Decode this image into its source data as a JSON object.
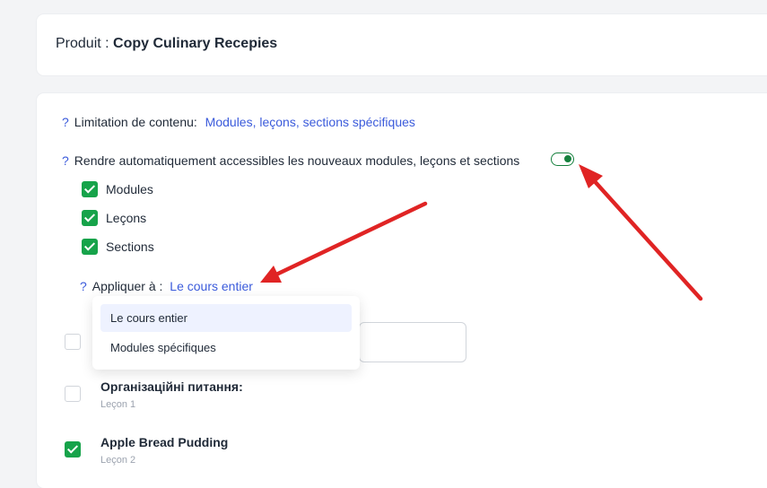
{
  "header": {
    "prefix": "Produit : ",
    "product_name": "Copy Culinary Recepies"
  },
  "content_limit": {
    "help": "?",
    "label": "Limitation de contenu:",
    "value": "Modules, leçons, sections spécifiques"
  },
  "auto_access": {
    "help": "?",
    "label": "Rendre automatiquement accessibles les nouveaux modules, leçons et sections",
    "enabled": true
  },
  "auto_access_items": [
    {
      "label": "Modules",
      "checked": true
    },
    {
      "label": "Leçons",
      "checked": true
    },
    {
      "label": "Sections",
      "checked": true
    }
  ],
  "apply_to": {
    "help": "?",
    "label": "Appliquer à :",
    "value": "Le cours entier",
    "options": [
      "Le cours entier",
      "Modules spécifiques"
    ]
  },
  "lessons": [
    {
      "title": "Організаційні питання:",
      "subtitle": "Leçon 1",
      "checked": false
    },
    {
      "title": "Apple Bread Pudding",
      "subtitle": "Leçon 2",
      "checked": true
    }
  ],
  "colors": {
    "accent": "#3b5bdb",
    "success": "#16a34a",
    "arrow": "#e02424"
  }
}
